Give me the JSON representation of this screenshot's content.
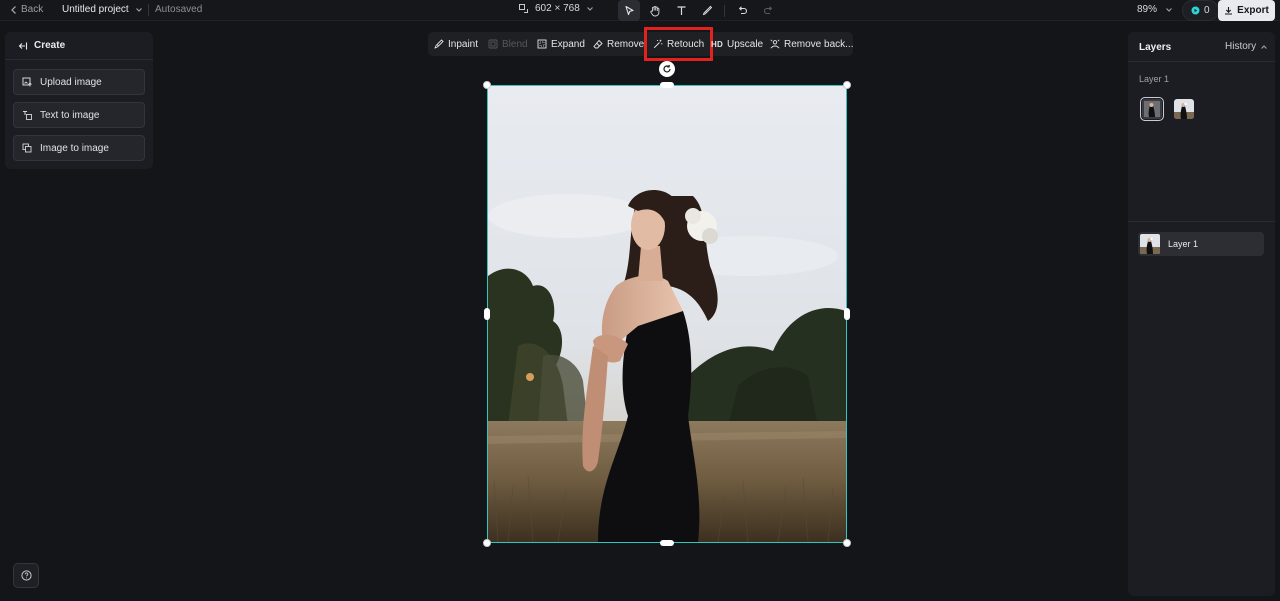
{
  "topbar": {
    "back_label": "Back",
    "project_name": "Untitled project",
    "status": "Autosaved",
    "canvas_size": "602 × 768",
    "zoom": "89%",
    "credits": "0",
    "export_label": "Export"
  },
  "tools": [
    "select-tool",
    "hand-tool",
    "text-tool",
    "brush-tool",
    "undo",
    "redo"
  ],
  "left_panel": {
    "title": "Create",
    "items": [
      {
        "label": "Upload image",
        "icon": "upload-image-icon"
      },
      {
        "label": "Text to image",
        "icon": "text-to-image-icon"
      },
      {
        "label": "Image to image",
        "icon": "image-to-image-icon"
      }
    ]
  },
  "floating_toolbar": {
    "items": [
      {
        "label": "Inpaint",
        "state": "enabled"
      },
      {
        "label": "Blend",
        "state": "disabled"
      },
      {
        "label": "Expand",
        "state": "enabled"
      },
      {
        "label": "Remove",
        "state": "enabled"
      },
      {
        "label": "Retouch",
        "state": "highlighted"
      },
      {
        "label": "Upscale",
        "badge": "HD",
        "state": "enabled"
      },
      {
        "label": "Remove back...",
        "state": "enabled"
      }
    ]
  },
  "right_panel": {
    "title": "Layers",
    "history_label": "History",
    "group_label": "Layer 1",
    "layer_row_label": "Layer 1"
  },
  "colors": {
    "background": "#141519",
    "panel": "#1c1d22",
    "selection_border": "#2fc7c0",
    "highlight": "#e0231f",
    "accent_credit": "#2fd3d8"
  }
}
